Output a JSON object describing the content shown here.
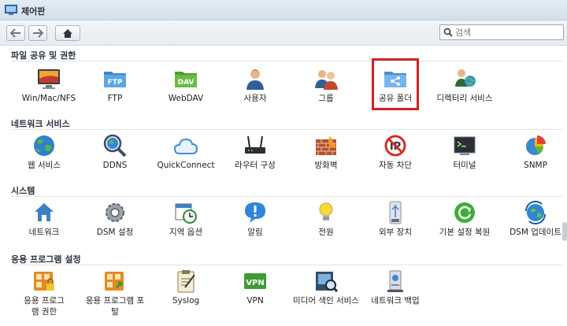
{
  "window": {
    "title": "제어판"
  },
  "search": {
    "placeholder": "검색",
    "value": ""
  },
  "sections": [
    {
      "title": "파일 공유 및 권한",
      "items": [
        {
          "label": "Win/Mac/NFS",
          "icon": "monitor-icon"
        },
        {
          "label": "FTP",
          "icon": "ftp-folder-icon"
        },
        {
          "label": "WebDAV",
          "icon": "dav-folder-icon"
        },
        {
          "label": "사용자",
          "icon": "user-icon"
        },
        {
          "label": "그룹",
          "icon": "group-icon"
        },
        {
          "label": "공유 폴더",
          "icon": "shared-folder-icon"
        },
        {
          "label": "디렉터리 서비스",
          "icon": "directory-service-icon"
        }
      ]
    },
    {
      "title": "네트워크 서비스",
      "items": [
        {
          "label": "웹 서비스",
          "icon": "globe-icon"
        },
        {
          "label": "DDNS",
          "icon": "magnifier-globe-icon"
        },
        {
          "label": "QuickConnect",
          "icon": "cloud-icon"
        },
        {
          "label": "라우터 구성",
          "icon": "router-icon"
        },
        {
          "label": "방화벽",
          "icon": "firewall-icon"
        },
        {
          "label": "자동 차단",
          "icon": "block-icon"
        },
        {
          "label": "터미널",
          "icon": "terminal-icon"
        },
        {
          "label": "SNMP",
          "icon": "pie-chart-icon"
        }
      ]
    },
    {
      "title": "시스템",
      "items": [
        {
          "label": "네트워크",
          "icon": "network-house-icon"
        },
        {
          "label": "DSM 설정",
          "icon": "gear-icon"
        },
        {
          "label": "지역 옵션",
          "icon": "calendar-clock-icon"
        },
        {
          "label": "알림",
          "icon": "notification-bubble-icon"
        },
        {
          "label": "전원",
          "icon": "lightbulb-icon"
        },
        {
          "label": "외부 장치",
          "icon": "usb-drive-icon"
        },
        {
          "label": "기본 설정 복원",
          "icon": "restore-icon"
        },
        {
          "label": "DSM 업데이트",
          "icon": "update-globe-icon"
        }
      ]
    },
    {
      "title": "응용 프로그램 설정",
      "items": [
        {
          "label": "응용 프로그램 권한",
          "icon": "app-privilege-icon"
        },
        {
          "label": "응용 프로그램 포털",
          "icon": "app-portal-icon"
        },
        {
          "label": "Syslog",
          "icon": "syslog-clipboard-icon"
        },
        {
          "label": "VPN",
          "icon": "vpn-icon"
        },
        {
          "label": "미디어 색인 서비스",
          "icon": "media-index-icon"
        },
        {
          "label": "네트워크 백업",
          "icon": "network-backup-icon"
        }
      ]
    }
  ],
  "colors": {
    "highlight": "#d62020",
    "titlebar": "#d3dfea"
  }
}
